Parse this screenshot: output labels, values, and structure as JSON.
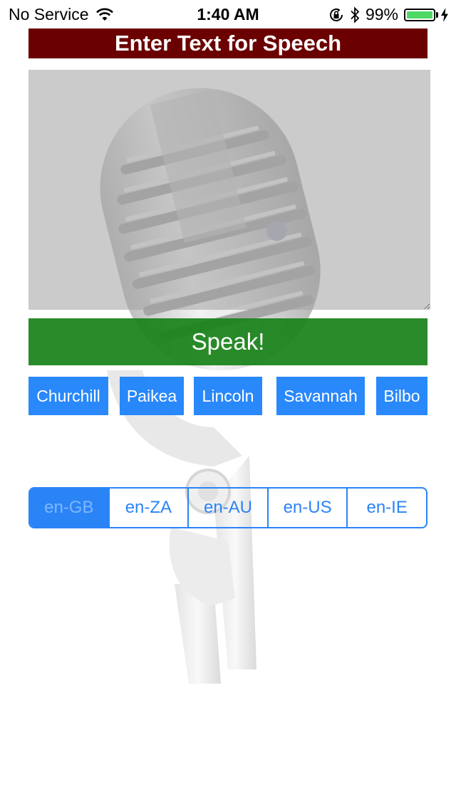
{
  "status_bar": {
    "carrier": "No Service",
    "time": "1:40 AM",
    "battery_percent": "99%",
    "battery_level": 0.99,
    "icons": [
      "wifi-icon",
      "rotation-lock-icon",
      "bluetooth-icon",
      "battery-icon",
      "charging-icon"
    ]
  },
  "title": "Enter Text for Speech",
  "speak_label": "Speak!",
  "voices": [
    "Churchill",
    "Paikea",
    "Lincoln",
    "Savannah",
    "Bilbo"
  ],
  "locales": {
    "options": [
      "en-GB",
      "en-ZA",
      "en-AU",
      "en-US",
      "en-IE"
    ],
    "selected": "en-GB"
  },
  "colors": {
    "title_bg": "#6b0000",
    "speak_bg": "#198219",
    "voice_bg": "#1e82fa",
    "accent": "#2a84f6",
    "battery_fill": "#4cd964"
  },
  "background_image": "vintage-microphone"
}
